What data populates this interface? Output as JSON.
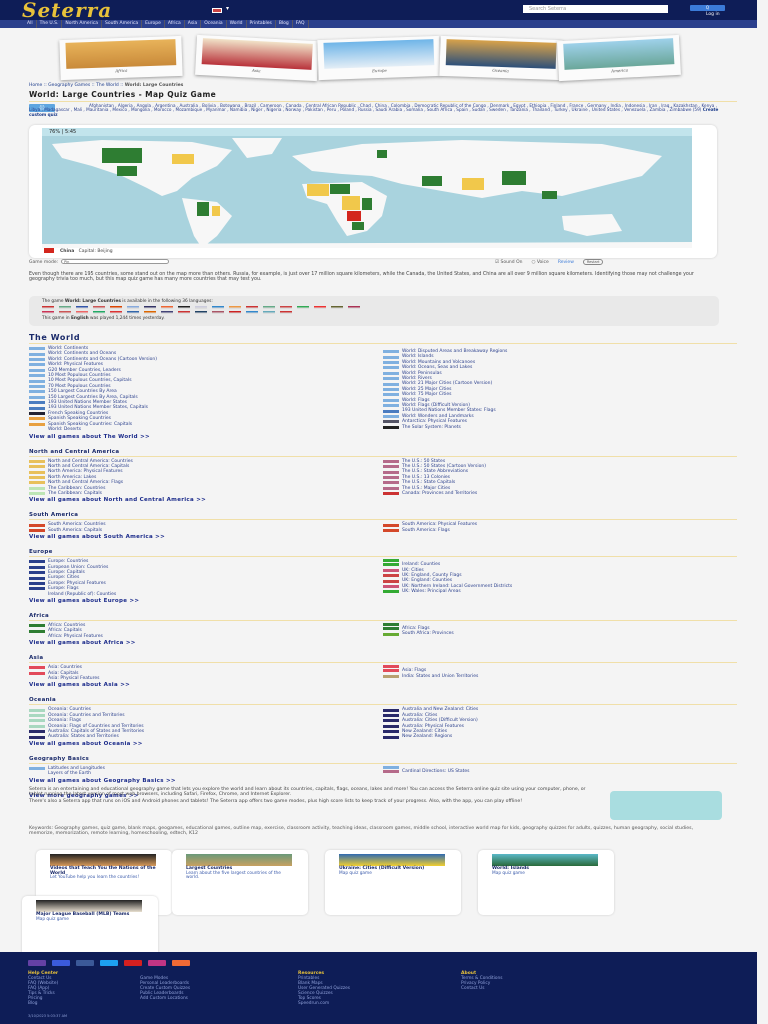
{
  "header": {
    "logo": "Seterra",
    "search_placeholder": "Search Seterra",
    "search_button": "Q",
    "login": "Log in"
  },
  "nav": [
    "All",
    "The U.S.",
    "North America",
    "South America",
    "Europe",
    "Africa",
    "Asia",
    "Oceania",
    "World",
    "Printables",
    "Blog",
    "FAQ"
  ],
  "banner": [
    {
      "caption": "Africa",
      "colors": [
        "#e8b35a",
        "#c98a3a"
      ]
    },
    {
      "caption": "Asia",
      "colors": [
        "#f1e3c9",
        "#b8313a"
      ]
    },
    {
      "caption": "Europe",
      "colors": [
        "#6fb5e8",
        "#e4eef6"
      ]
    },
    {
      "caption": "Oceania",
      "colors": [
        "#d8a24a",
        "#2c4f7a"
      ]
    },
    {
      "caption": "America",
      "colors": [
        "#9ed1ea",
        "#6ba79a"
      ]
    }
  ],
  "breadcrumb": {
    "text": "Home :: Geography Games :: The World :: ",
    "current": "World: Large Countries"
  },
  "title": "World: Large Countries - Map Quiz Game",
  "tags": {
    "icon": "tags-icon",
    "text": "Afghanistan , Algeria , Angola , Argentina , Australia , Bolivia , Botswana , Brazil , Cameroon , Canada , Central African Republic , Chad , China , Colombia , Democratic Republic of the Congo , Denmark , Egypt , Ethiopia , Finland , France , Germany , India , Indonesia , Iran , Iraq , Kazakhstan , Kenya , Libya , Madagascar , Mali , Mauritania , Mexico , Mongolia , Morocco , Mozambique , Myanmar , Namibia , Niger , Nigeria , Norway , Pakistan , Peru , Poland , Russia , Saudi Arabia , Somalia , South Africa , Spain , Sudan , Sweden , Tanzania , Thailand , Turkey , Ukraine , United States , Venezuela , Zambia , Zimbabwe (59)",
    "custom": "Create custom quiz"
  },
  "game": {
    "score": "76% | 5:45",
    "answer_country": "China",
    "answer_capital": "Capital: Beijing",
    "mode_label": "Game mode:",
    "mode_value": "Pin",
    "sound": "Sound On",
    "voice": "Voice",
    "review": "Review",
    "restart": "Restart",
    "colors": {
      "ocean": "#a9d3de",
      "land": "#f7f7f7",
      "correct": "#2e7d32",
      "wrong": "#f1c84b",
      "miss": "#d3261d"
    }
  },
  "intro": "Even though there are 195 countries, some stand out on the map more than others. Russia, for example, is just over 17 million square kilometers, while the Canada, the United States, and China are all over 9 million square kilometers. Identifying those may not challenge your geography trivia too much, but this map quiz game has many more countries that may test you.",
  "languages": {
    "pre": "The game ",
    "game": "World: Large Countries",
    "post": " is available in the following 36 languages:",
    "played_pre": "This game in ",
    "played_lang": "English",
    "played_post": " was played 1,244 times yesterday.",
    "flags": [
      "#c33",
      "#6a8",
      "#35a",
      "#c55",
      "#d40",
      "#8ad",
      "#336",
      "#e63",
      "#222",
      "#ccd",
      "#38c",
      "#e94",
      "#c33",
      "#6a8",
      "#c44",
      "#3a5",
      "#e33",
      "#663",
      "#a35",
      "#c35",
      "#c55",
      "#e66",
      "#2a6",
      "#d33",
      "#36a",
      "#d60",
      "#447",
      "#c33",
      "#246",
      "#a56",
      "#c22",
      "#38c",
      "#6ab",
      "#c33"
    ]
  },
  "sections": [
    {
      "title": "The World",
      "big": true,
      "left": [
        [
          "World: Continents",
          "#7fb0e0"
        ],
        [
          "World: Continents and Oceans",
          "#7fb0e0"
        ],
        [
          "World: Continents and Oceans (Cartoon Version)",
          "#7fb0e0"
        ],
        [
          "World: Physical Features",
          "#7fb0e0"
        ],
        [
          "G20 Member Countries, Leaders",
          "#7fb0e0"
        ],
        [
          "10 Most Populous Countries",
          "#7fb0e0"
        ],
        [
          "10 Most Populous Countries, Capitals",
          "#7fb0e0"
        ],
        [
          "70 Most Populous Countries",
          "#7fb0e0"
        ],
        [
          "150 Largest Countries By Area",
          "#7fb0e0"
        ],
        [
          "150 Largest Countries By Area, Capitals",
          "#7fb0e0"
        ],
        [
          "193 United Nations Member States",
          "#4a7cc0"
        ],
        [
          "193 United Nations Member States, Capitals",
          "#4a7cc0"
        ],
        [
          "French Speaking Countries",
          "#223"
        ],
        [
          "Spanish Speaking Countries",
          "#e8a040"
        ],
        [
          "Spanish Speaking Countries: Capitals",
          "#e8a040"
        ],
        [
          "World: Deserts",
          ""
        ]
      ],
      "right": [
        [
          "",
          ""
        ],
        [
          "World: Disputed Areas and Breakaway Regions",
          "#7fb0e0"
        ],
        [
          "World: Islands",
          "#7fb0e0"
        ],
        [
          "World: Mountains and Volcanoes",
          "#7fb0e0"
        ],
        [
          "World: Oceans, Seas and Lakes",
          "#7fb0e0"
        ],
        [
          "World: Peninsulas",
          "#7fb0e0"
        ],
        [
          "World: Rivers",
          "#7fb0e0"
        ],
        [
          "World: 21 Major Cities (Cartoon Version)",
          "#7fb0e0"
        ],
        [
          "World: 25 Major Cities",
          "#7fb0e0"
        ],
        [
          "World: 75 Major Cities",
          "#7fb0e0"
        ],
        [
          "World: Flags",
          "#7fb0e0"
        ],
        [
          "World: Flags (Difficult Version)",
          "#7fb0e0"
        ],
        [
          "193 United Nations Member States: Flags",
          "#4a7cc0"
        ],
        [
          "World: Wonders and Landmarks",
          "#7fb0e0"
        ],
        [
          "Antarctica: Physical Features",
          "#556"
        ],
        [
          "The Solar System: Planets",
          "#222"
        ]
      ],
      "all": "View all games about The World >>"
    },
    {
      "title": "North and Central America",
      "left": [
        [
          "North and Central America: Countries",
          "#e8c05a"
        ],
        [
          "North and Central America: Capitals",
          "#e8c05a"
        ],
        [
          "North America: Physical Features",
          "#e8c05a"
        ],
        [
          "North America: Lakes",
          "#e8c05a"
        ],
        [
          "North and Central America: Flags",
          "#e8c05a"
        ],
        [
          "The Caribbean: Countries",
          "#bde5b5"
        ],
        [
          "The Caribbean: Capitals",
          "#bde5b5"
        ]
      ],
      "right": [
        [
          "The U.S.: 50 States",
          "#b56a8a"
        ],
        [
          "The U.S.: 50 States (Cartoon Version)",
          "#b56a8a"
        ],
        [
          "The U.S.: State Abbreviations",
          "#b56a8a"
        ],
        [
          "The U.S.: 13 Colonies",
          "#b56a8a"
        ],
        [
          "The U.S.: State Capitals",
          "#b56a8a"
        ],
        [
          "The U.S.: Major Cities",
          "#b56a8a"
        ],
        [
          "Canada: Provinces and Territories",
          "#c33"
        ]
      ],
      "all": "View all games about North and Central America >>"
    },
    {
      "title": "South America",
      "left": [
        [
          "South America: Countries",
          "#d4482a"
        ],
        [
          "South America: Capitals",
          "#d4482a"
        ]
      ],
      "right": [
        [
          "South America: Physical Features",
          "#d4482a"
        ],
        [
          "South America: Flags",
          "#d4482a"
        ]
      ],
      "all": "View all games about South America >>"
    },
    {
      "title": "Europe",
      "left": [
        [
          "Europe: Countries",
          "#2a3f8c"
        ],
        [
          "European Union: Countries",
          "#2a3f8c"
        ],
        [
          "Europe: Capitals",
          "#2a3f8c"
        ],
        [
          "Europe: Cities",
          "#2a3f8c"
        ],
        [
          "Europe: Physical Features",
          "#2a3f8c"
        ],
        [
          "Europe: Flags",
          "#2a3f8c"
        ],
        [
          "Ireland (Republic of): Counties",
          ""
        ]
      ],
      "right": [
        [
          "",
          "#3a3"
        ],
        [
          "Ireland: Counties",
          "#3a3"
        ],
        [
          "UK: Cities",
          "#c57"
        ],
        [
          "UK: England, County Flags",
          "#c44"
        ],
        [
          "UK: England: Counties",
          "#c44"
        ],
        [
          "UK: Northern Ireland: Local Government Districts",
          "#c57"
        ],
        [
          "UK: Wales: Principal Areas",
          "#3a3"
        ]
      ],
      "all": "View all games about Europe >>"
    },
    {
      "title": "Africa",
      "left": [
        [
          "Africa: Countries",
          "#2e7d32"
        ],
        [
          "Africa: Capitals",
          "#2e7d32"
        ],
        [
          "Africa: Physical Features",
          ""
        ]
      ],
      "right": [
        [
          "",
          "#2e7d32"
        ],
        [
          "Africa: Flags",
          "#2e7d32"
        ],
        [
          "South Africa: Provinces",
          "#6a3"
        ]
      ],
      "all": "View all games about Africa >>"
    },
    {
      "title": "Asia",
      "left": [
        [
          "Asia: Countries",
          "#e24a5a"
        ],
        [
          "Asia: Capitals",
          "#e24a5a"
        ],
        [
          "Asia: Physical Features",
          ""
        ]
      ],
      "right": [
        [
          "",
          "#e24a5a"
        ],
        [
          "Asia: Flags",
          "#e24a5a"
        ],
        [
          "India: States and Union Territories",
          "#b8a070"
        ]
      ],
      "all": "View all games about Asia >>"
    },
    {
      "title": "Oceania",
      "left": [
        [
          "Oceania: Countries",
          "#a9d8c0"
        ],
        [
          "Oceania: Countries and Territories",
          "#a9d8c0"
        ],
        [
          "Oceania: Flags",
          "#a9d8c0"
        ],
        [
          "Oceania: Flags of Countries and Territories",
          "#a9d8c0"
        ],
        [
          "Australia: Capitals of States and Territories",
          "#2a2a6a"
        ],
        [
          "Australia: States and Territories",
          "#2a2a6a"
        ]
      ],
      "right": [
        [
          "Australia and New Zealand: Cities",
          "#2a2a6a"
        ],
        [
          "Australia: Cities",
          "#2a2a6a"
        ],
        [
          "Australia: Cities (Difficult Version)",
          "#2a2a6a"
        ],
        [
          "Australia: Physical Features",
          "#2a2a6a"
        ],
        [
          "New Zealand: Cities",
          "#2a2a6a"
        ],
        [
          "New Zealand: Regions",
          "#2a2a6a"
        ]
      ],
      "all": "View all games about Oceania >>"
    },
    {
      "title": "Geography Basics",
      "left": [
        [
          "Latitudes and Longitudes",
          "#7fb0e0"
        ],
        [
          "Layers of the Earth",
          ""
        ]
      ],
      "right": [
        [
          "",
          "#7fb0e0"
        ],
        [
          "Cardinal Directions: US States",
          "#b56a8a"
        ]
      ],
      "all": "View all games about Geography Basics >>"
    }
  ],
  "view_more": "View more geography games >>",
  "about": [
    "Seterra is an entertaining and educational geography game that lets you explore the world and learn about its countries, capitals, flags, oceans, lakes and more! You can access the Seterra online quiz site using your computer, phone, or tablet running the latest version of most web browsers, including Safari, Firefox, Chrome, and Internet Explorer.",
    "There's also a Seterra app that runs on iOS and Android phones and tablets! The Seterra app offers two game modes, plus high score lists to keep track of your progress. Also, with the app, you can play offline!"
  ],
  "keywords": "Keywords: Geography games, quiz game, blank maps, geogames, educational games, outline map, exercise, classroom activity, teaching ideas, classroom games, middle school, interactive world map for kids, geography quizzes for adults, quizzes, human geography, social studies, memorize, memorization, remote learning, homeschooling, edtech, K12",
  "cards": [
    {
      "title": "Videos that Teach You the Nations of the World",
      "desc": "Let YouTube help you learn the countries!",
      "colors": [
        "#222",
        "#d89a5a"
      ]
    },
    {
      "title": "Largest Countries",
      "desc": "Learn about the five largest countries of the world.",
      "colors": [
        "#6a9a7a",
        "#c8a060"
      ]
    },
    {
      "title": "Ukraine: Cities (Difficult Version)",
      "desc": "Map quiz game",
      "colors": [
        "#2f6ab0",
        "#f2cf2f"
      ]
    },
    {
      "title": "World: Islands",
      "desc": "Map quiz game",
      "colors": [
        "#5ab8c8",
        "#2a6a3a"
      ]
    },
    {
      "title": "Major League Baseball (MLB) Teams",
      "desc": "Map quiz game",
      "colors": [
        "#222",
        "#e8e0d0"
      ]
    }
  ],
  "footer": {
    "social": [
      [
        "twitch-icon",
        "#6441a5"
      ],
      [
        "messenger-icon",
        "#3b5bdb"
      ],
      [
        "facebook-icon",
        "#3b5998"
      ],
      [
        "twitter-icon",
        "#1da1f2"
      ],
      [
        "youtube-icon",
        "#d42020"
      ],
      [
        "instagram-icon",
        "#c13584"
      ],
      [
        "blogger-icon",
        "#f06a35"
      ]
    ],
    "cols": [
      {
        "title": "Help Center",
        "links": [
          "Contact Us",
          "FAQ (Website)",
          "FAQ (App)",
          "Tips & Tricks",
          "Pricing",
          "Blog"
        ]
      },
      {
        "title": "",
        "links": [
          "Game Modes",
          "Personal Leaderboards",
          "Create Custom Quizzes",
          "Public Leaderboards",
          "Add Custom Locations"
        ]
      },
      {
        "title": "Resources",
        "links": [
          "Printables",
          "Blank Maps",
          "User Generated Quizzes",
          "Science Quizzes",
          "Top Scores",
          "Speedrun.com"
        ]
      },
      {
        "title": "About",
        "links": [
          "Terms & Conditions",
          "Privacy Policy",
          "Contact Us"
        ]
      }
    ],
    "timestamp": "3/10/2023 5:03:37 AM"
  }
}
